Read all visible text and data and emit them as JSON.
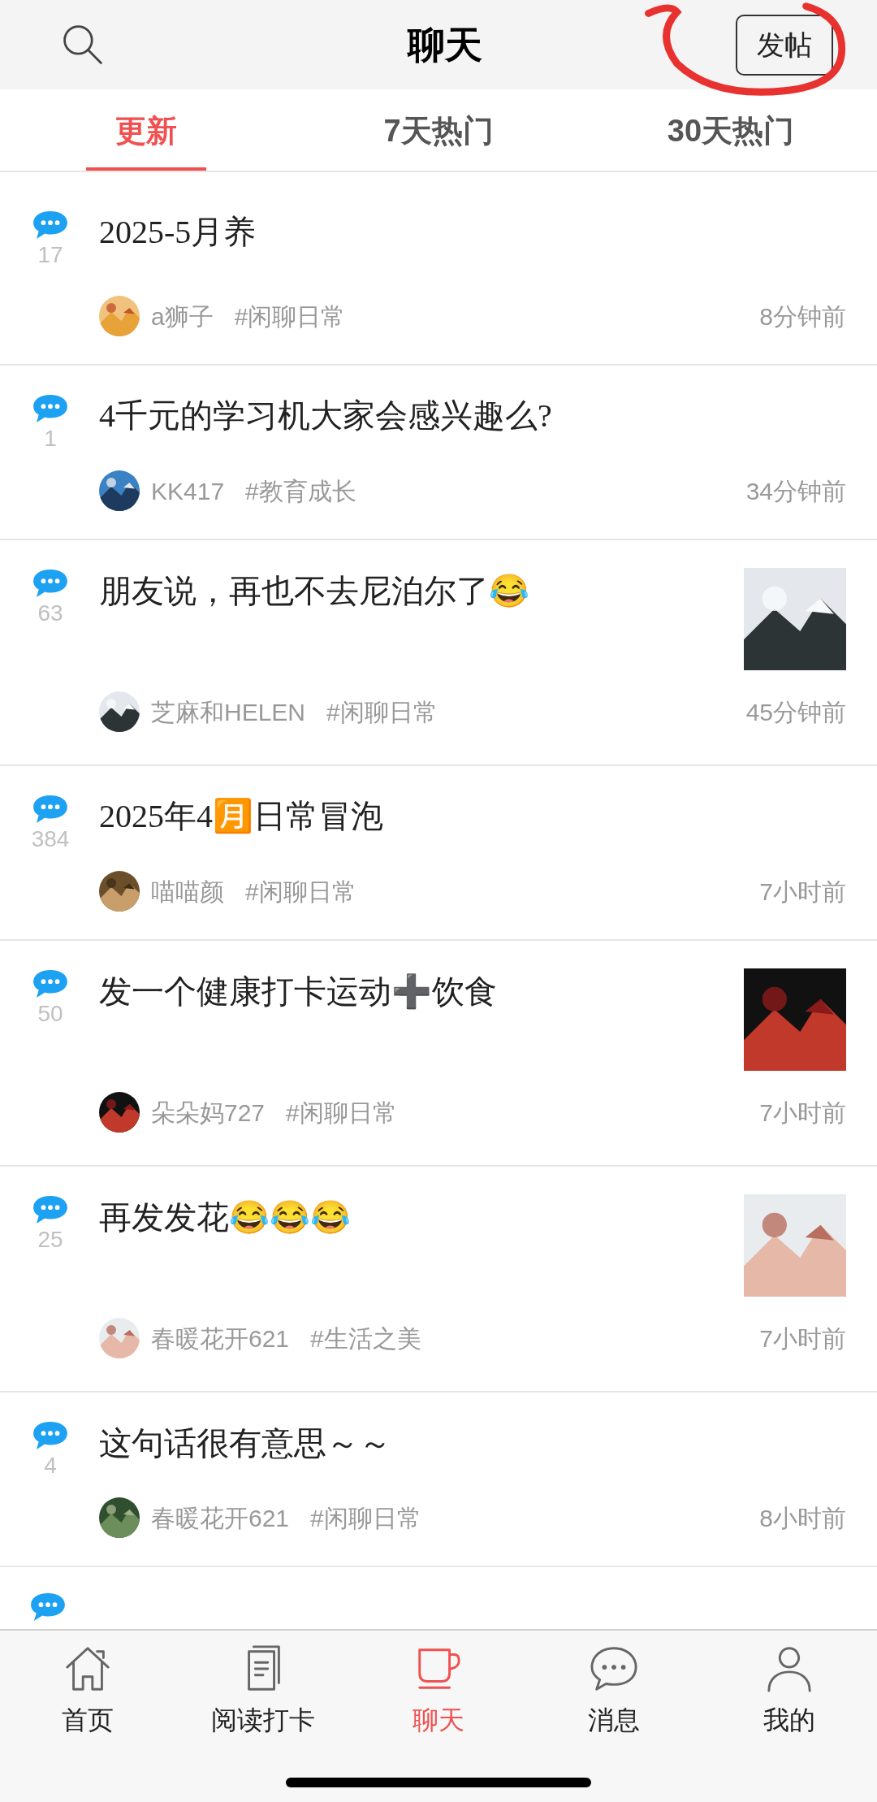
{
  "header": {
    "title": "聊天",
    "post_button": "发帖"
  },
  "tabs": [
    {
      "label": "更新",
      "selected": true
    },
    {
      "label": "7天热门",
      "selected": false
    },
    {
      "label": "30天热门",
      "selected": false
    }
  ],
  "posts": [
    {
      "count": "17",
      "title": "2025-5月养",
      "user": "a狮子",
      "tag": "#闲聊日常",
      "time": "8分钟前",
      "thumbnail": false
    },
    {
      "count": "1",
      "title": "4千元的学习机大家会感兴趣么?",
      "user": "KK417",
      "tag": "#教育成长",
      "time": "34分钟前",
      "thumbnail": false
    },
    {
      "count": "63",
      "title": "朋友说，再也不去尼泊尔了😂",
      "user": "芝麻和HELEN",
      "tag": "#闲聊日常",
      "time": "45分钟前",
      "thumbnail": true
    },
    {
      "count": "384",
      "title": "2025年4🈷️日常冒泡",
      "user": "喵喵颜",
      "tag": "#闲聊日常",
      "time": "7小时前",
      "thumbnail": false
    },
    {
      "count": "50",
      "title": "发一个健康打卡运动➕饮食",
      "user": "朵朵妈727",
      "tag": "#闲聊日常",
      "time": "7小时前",
      "thumbnail": true
    },
    {
      "count": "25",
      "title": "再发发花😂😂😂",
      "user": "春暖花开621",
      "tag": "#生活之美",
      "time": "7小时前",
      "thumbnail": true
    },
    {
      "count": "4",
      "title": "这句话很有意思～～",
      "user": "春暖花开621",
      "tag": "#闲聊日常",
      "time": "8小时前",
      "thumbnail": false
    }
  ],
  "nav": [
    {
      "label": "首页",
      "kind": "home",
      "selected": false
    },
    {
      "label": "阅读打卡",
      "kind": "book",
      "selected": false
    },
    {
      "label": "聊天",
      "kind": "cup",
      "selected": true
    },
    {
      "label": "消息",
      "kind": "chat",
      "selected": false
    },
    {
      "label": "我的",
      "kind": "user",
      "selected": false
    }
  ]
}
